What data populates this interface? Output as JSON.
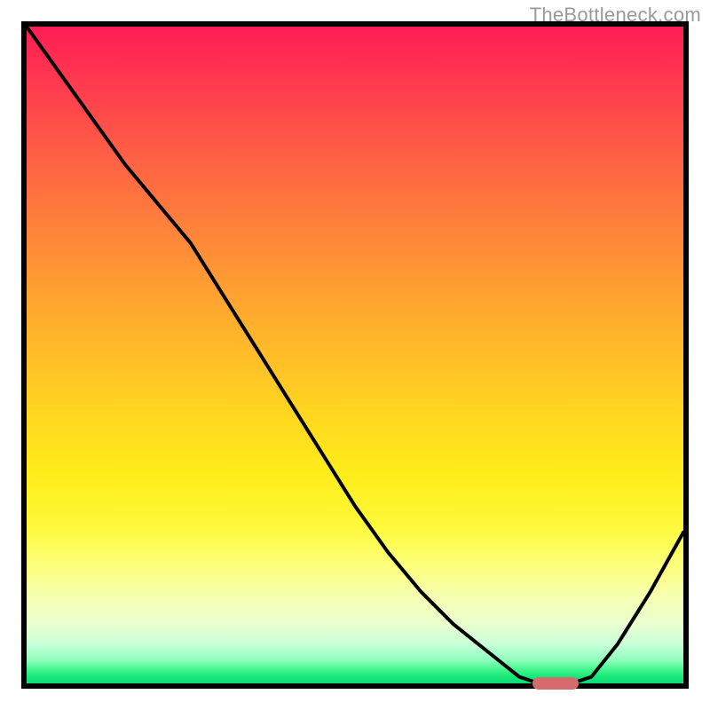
{
  "watermark": "TheBottleneck.com",
  "colors": {
    "curve": "#000000",
    "marker": "#d66b6e",
    "frame": "#000000",
    "gradient_top": "#ff1c55",
    "gradient_mid": "#ffd421",
    "gradient_bottom": "#0ade72"
  },
  "chart_data": {
    "type": "line",
    "title": "",
    "xlabel": "",
    "ylabel": "",
    "xlim": [
      0,
      100
    ],
    "ylim": [
      0,
      100
    ],
    "grid": false,
    "legend": false,
    "series": [
      {
        "name": "bottleneck-curve",
        "x": [
          0,
          5,
          10,
          15,
          20,
          25,
          30,
          35,
          40,
          45,
          50,
          55,
          60,
          65,
          70,
          75,
          78,
          81,
          83,
          86,
          90,
          95,
          100
        ],
        "y": [
          100,
          93,
          86,
          79,
          73,
          67,
          59,
          51,
          43,
          35,
          27,
          20,
          14,
          9,
          5,
          1,
          0,
          0,
          0,
          1,
          6,
          14,
          23
        ]
      }
    ],
    "marker": {
      "name": "highlight-segment",
      "x_start": 77,
      "x_end": 84,
      "y": 0
    },
    "axes_visible": false
  }
}
